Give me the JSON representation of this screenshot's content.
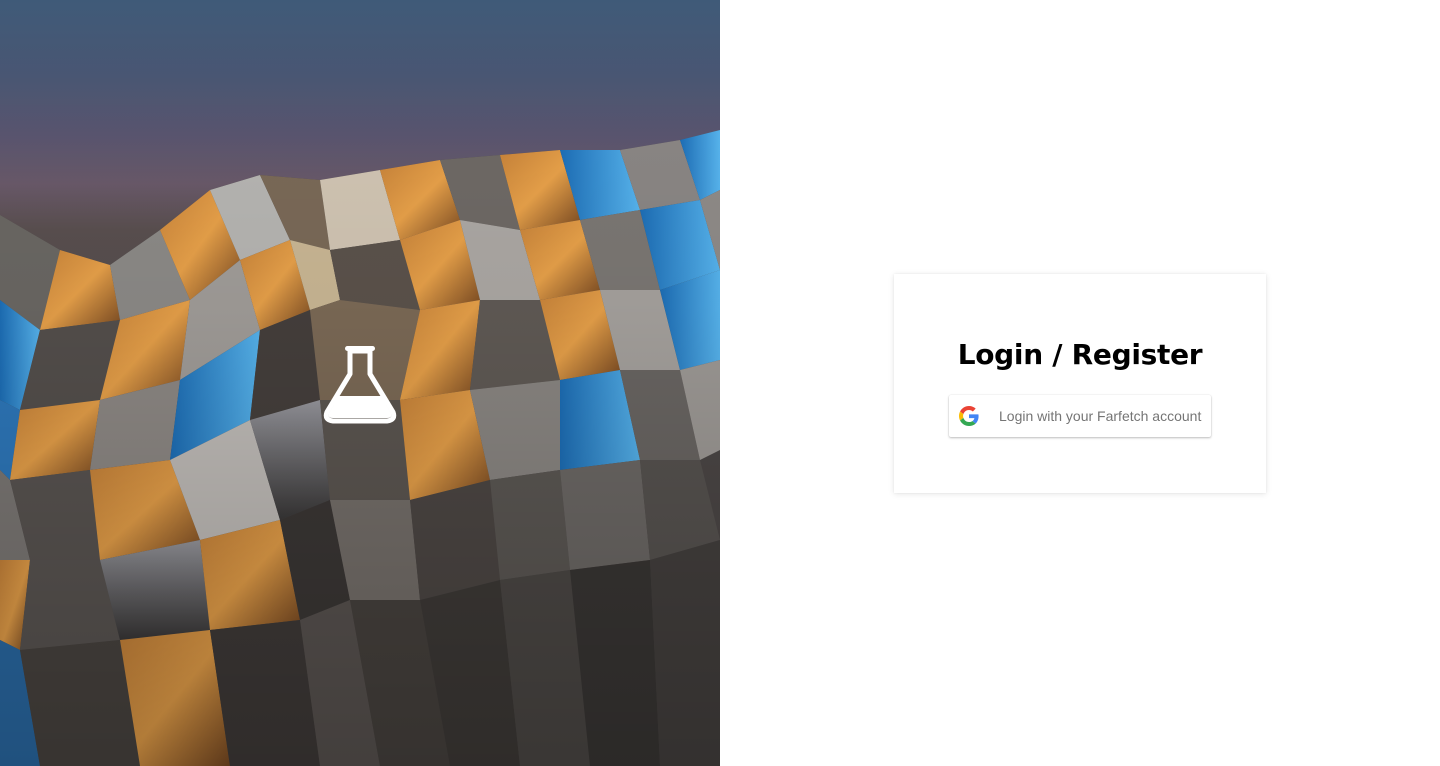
{
  "hero": {
    "logo_icon": "flask-icon"
  },
  "login": {
    "title": "Login / Register",
    "google_button": {
      "icon": "google-g-icon",
      "label": "Login with your Farfetch account"
    }
  },
  "colors": {
    "card_background": "#ffffff",
    "title_text": "#000000",
    "button_text": "#757575",
    "google_blue": "#4285F4",
    "google_red": "#EA4335",
    "google_yellow": "#FBBC05",
    "google_green": "#34A853"
  }
}
